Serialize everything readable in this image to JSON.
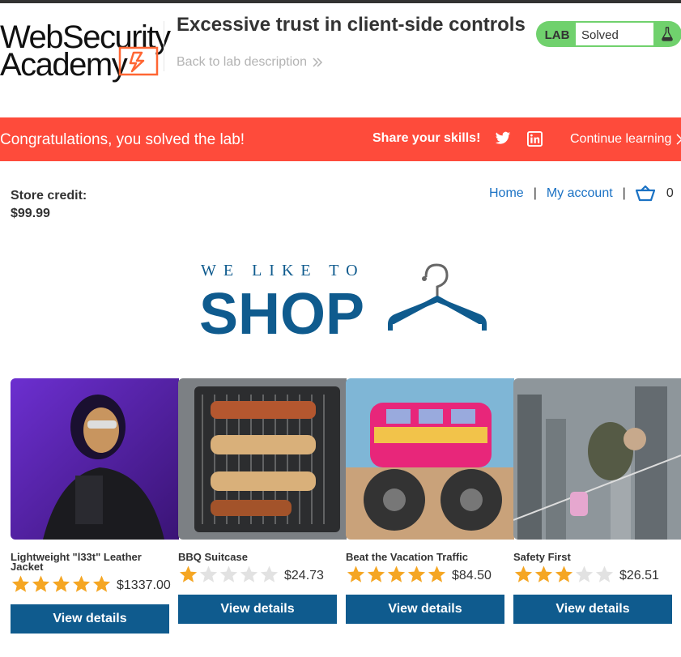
{
  "header": {
    "logo_line1": "WebSecurity",
    "logo_line2": "Academy",
    "lab_title": "Excessive trust in client-side controls",
    "back_link": "Back to lab description",
    "lab_badge": "LAB",
    "lab_status": "Solved"
  },
  "banner": {
    "message": "Congratulations, you solved the lab!",
    "share": "Share your skills!",
    "continue": "Continue learning"
  },
  "store": {
    "credit_label": "Store credit:",
    "credit_value": "$99.99",
    "nav": {
      "home": "Home",
      "separator": "|",
      "account": "My account",
      "cart_count": "0"
    },
    "logo_tagline": "WE LIKE TO",
    "logo_word": "SHOP"
  },
  "colors": {
    "banner": "#fe4b3b",
    "lab_green": "#70d16d",
    "button": "#0f5b8e",
    "link": "#1b72c4",
    "star": "#f5a623"
  },
  "products": [
    {
      "name": "Lightweight \"l33t\" Leather Jacket",
      "rating": 5,
      "price": "$1337.00",
      "button": "View details"
    },
    {
      "name": "BBQ Suitcase",
      "rating": 1,
      "price": "$24.73",
      "button": "View details"
    },
    {
      "name": "Beat the Vacation Traffic",
      "rating": 5,
      "price": "$84.50",
      "button": "View details"
    },
    {
      "name": "Safety First",
      "rating": 3,
      "price": "$26.51",
      "button": "View details"
    }
  ]
}
